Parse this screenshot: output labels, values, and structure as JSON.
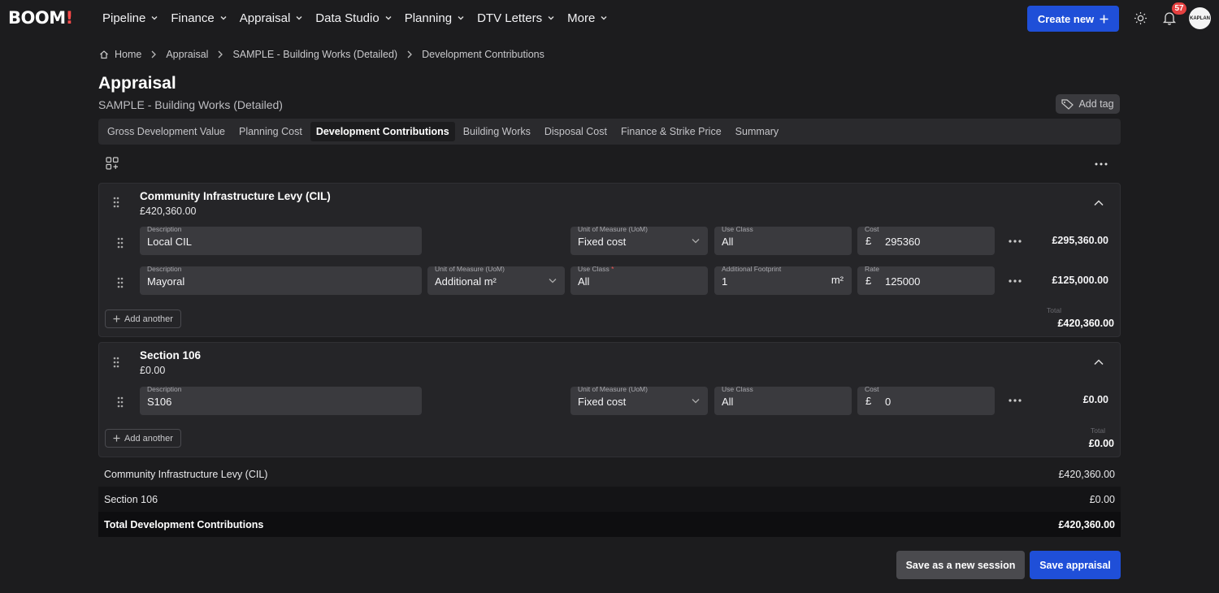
{
  "app": {
    "logo_text": "BOOM",
    "logo_bang": "!"
  },
  "nav": {
    "items": [
      "Pipeline",
      "Finance",
      "Appraisal",
      "Data Studio",
      "Planning",
      "DTV Letters",
      "More"
    ],
    "create_label": "Create new",
    "notifications_count": "57",
    "avatar_text": "KAPLAN"
  },
  "breadcrumb": [
    "Home",
    "Appraisal",
    "SAMPLE - Building Works (Detailed)",
    "Development Contributions"
  ],
  "header": {
    "title": "Appraisal",
    "subtitle": "SAMPLE - Building Works (Detailed)",
    "add_tag_label": "Add tag"
  },
  "tabs": [
    "Gross Development Value",
    "Planning Cost",
    "Development Contributions",
    "Building Works",
    "Disposal Cost",
    "Finance & Strike Price",
    "Summary"
  ],
  "active_tab": "Development Contributions",
  "cil": {
    "title": "Community Infrastructure Levy (CIL)",
    "amount": "£420,360.00",
    "rows": [
      {
        "description_label": "Description",
        "description": "Local CIL",
        "uom_label": "Unit of Measure (UoM)",
        "uom": "Fixed cost",
        "use_class_label": "Use Class",
        "use_class": "All",
        "cost_label": "Cost",
        "currency": "£",
        "cost": "295360",
        "total": "£295,360.00"
      },
      {
        "description_label": "Description",
        "description": "Mayoral",
        "uom_label": "Unit of Measure (UoM)",
        "uom": "Additional m²",
        "use_class_label": "Use Class",
        "use_class": "All",
        "footprint_label": "Additional Footprint",
        "footprint": "1",
        "footprint_unit": "m²",
        "rate_label": "Rate",
        "currency": "£",
        "rate": "125000",
        "total": "£125,000.00"
      }
    ],
    "add_another": "Add another",
    "total_label": "Total",
    "total": "£420,360.00"
  },
  "s106": {
    "title": "Section 106",
    "amount": "£0.00",
    "rows": [
      {
        "description_label": "Description",
        "description": "S106",
        "uom_label": "Unit of Measure (UoM)",
        "uom": "Fixed cost",
        "use_class_label": "Use Class",
        "use_class": "All",
        "cost_label": "Cost",
        "currency": "£",
        "cost": "0",
        "total": "£0.00"
      }
    ],
    "add_another": "Add another",
    "total_label": "Total",
    "total": "£0.00"
  },
  "summary": [
    {
      "label": "Community Infrastructure Levy (CIL)",
      "value": "£420,360.00"
    },
    {
      "label": "Section 106",
      "value": "£0.00"
    },
    {
      "label": "Total Development Contributions",
      "value": "£420,360.00"
    }
  ],
  "actions": {
    "save_session": "Save as a new session",
    "save_appraisal": "Save appraisal"
  },
  "colors": {
    "accent": "#1f4fd8",
    "background": "#1c1c1e",
    "badge": "#e54040"
  }
}
